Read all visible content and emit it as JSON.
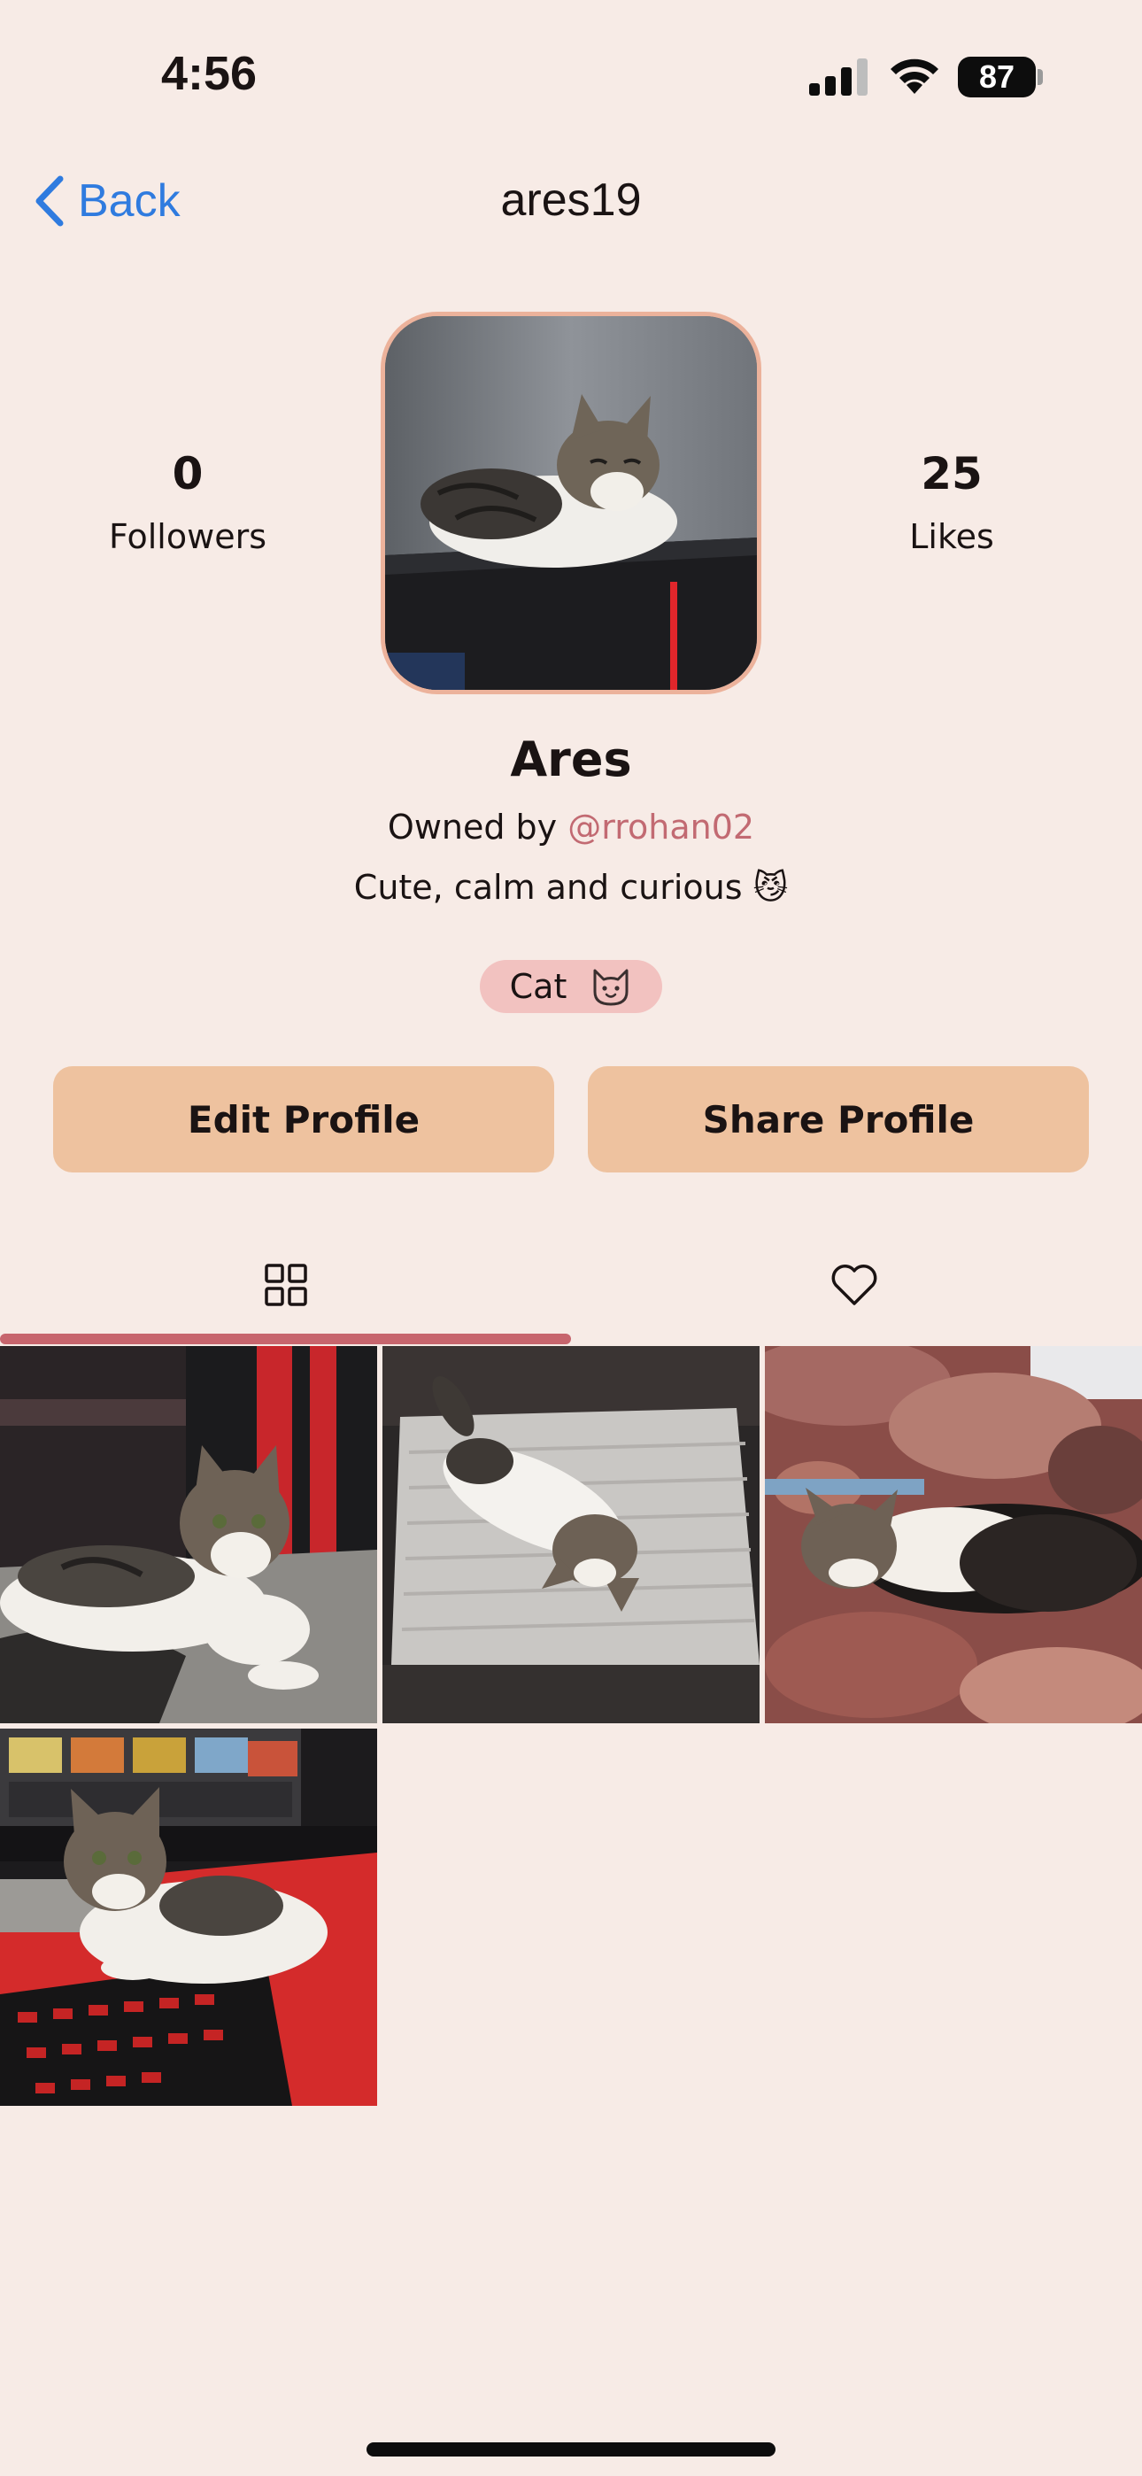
{
  "status_bar": {
    "time": "4:56",
    "battery": "87"
  },
  "nav": {
    "back_label": "Back",
    "title": "ares19"
  },
  "profile": {
    "followers_count": "0",
    "followers_label": "Followers",
    "likes_count": "25",
    "likes_label": "Likes",
    "pet_name": "Ares",
    "owned_by_prefix": "Owned by",
    "owner_handle": "@rrohan02",
    "bio": "Cute, calm and curious 😼",
    "species": "Cat"
  },
  "actions": {
    "edit_label": "Edit Profile",
    "share_label": "Share Profile"
  },
  "tabs": [
    {
      "icon": "grid-icon",
      "active": true
    },
    {
      "icon": "heart-icon",
      "active": false
    }
  ],
  "posts": [
    {
      "icon": "cat-photo"
    },
    {
      "icon": "cat-photo"
    },
    {
      "icon": "cat-photo"
    },
    {
      "icon": "cat-photo"
    }
  ],
  "colors": {
    "background": "#f7ebe6",
    "accent": "#c7656d",
    "button": "#eec29f",
    "badge": "#f2c2c0",
    "link": "#2f7bdf"
  }
}
